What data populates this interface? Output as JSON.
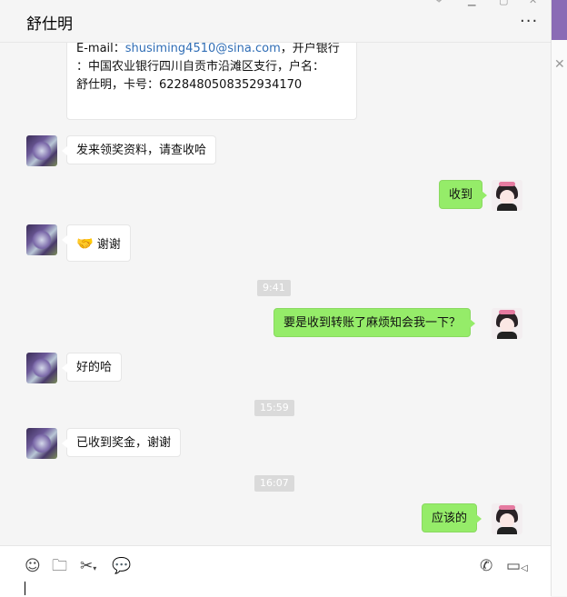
{
  "header": {
    "title": "舒仕明",
    "more_icon": "more-icon"
  },
  "first_message": {
    "line1_prefix": "E-mail：",
    "email": "shusiming4510@sina.com",
    "line1_suffix": "，开户银行",
    "line2": "：中国农业银行四川自贡市沿滩区支行，户名：",
    "line3": "舒仕明，卡号：6228480508352934170"
  },
  "messages": [
    {
      "side": "left",
      "text": "发来领奖资料，请查收哈"
    },
    {
      "side": "right",
      "text": "收到"
    },
    {
      "side": "left",
      "text": "谢谢",
      "emoji": "🤝"
    },
    {
      "type": "time",
      "text": "9:41"
    },
    {
      "side": "right",
      "text": "要是收到转账了麻烦知会我一下？"
    },
    {
      "side": "left",
      "text": "好的哈"
    },
    {
      "type": "time",
      "text": "15:59"
    },
    {
      "side": "left",
      "text": "已收到奖金，谢谢"
    },
    {
      "type": "time",
      "text": "16:07"
    },
    {
      "side": "right",
      "text": "应该的"
    }
  ],
  "toolbar": {
    "icons": [
      "emoji-icon",
      "folder-icon",
      "scissors-icon",
      "chat-bubble-icon",
      "phone-icon",
      "video-icon"
    ]
  },
  "colors": {
    "sent_bubble": "#95ec69",
    "received_bubble": "#ffffff",
    "link": "#2f6db5"
  }
}
